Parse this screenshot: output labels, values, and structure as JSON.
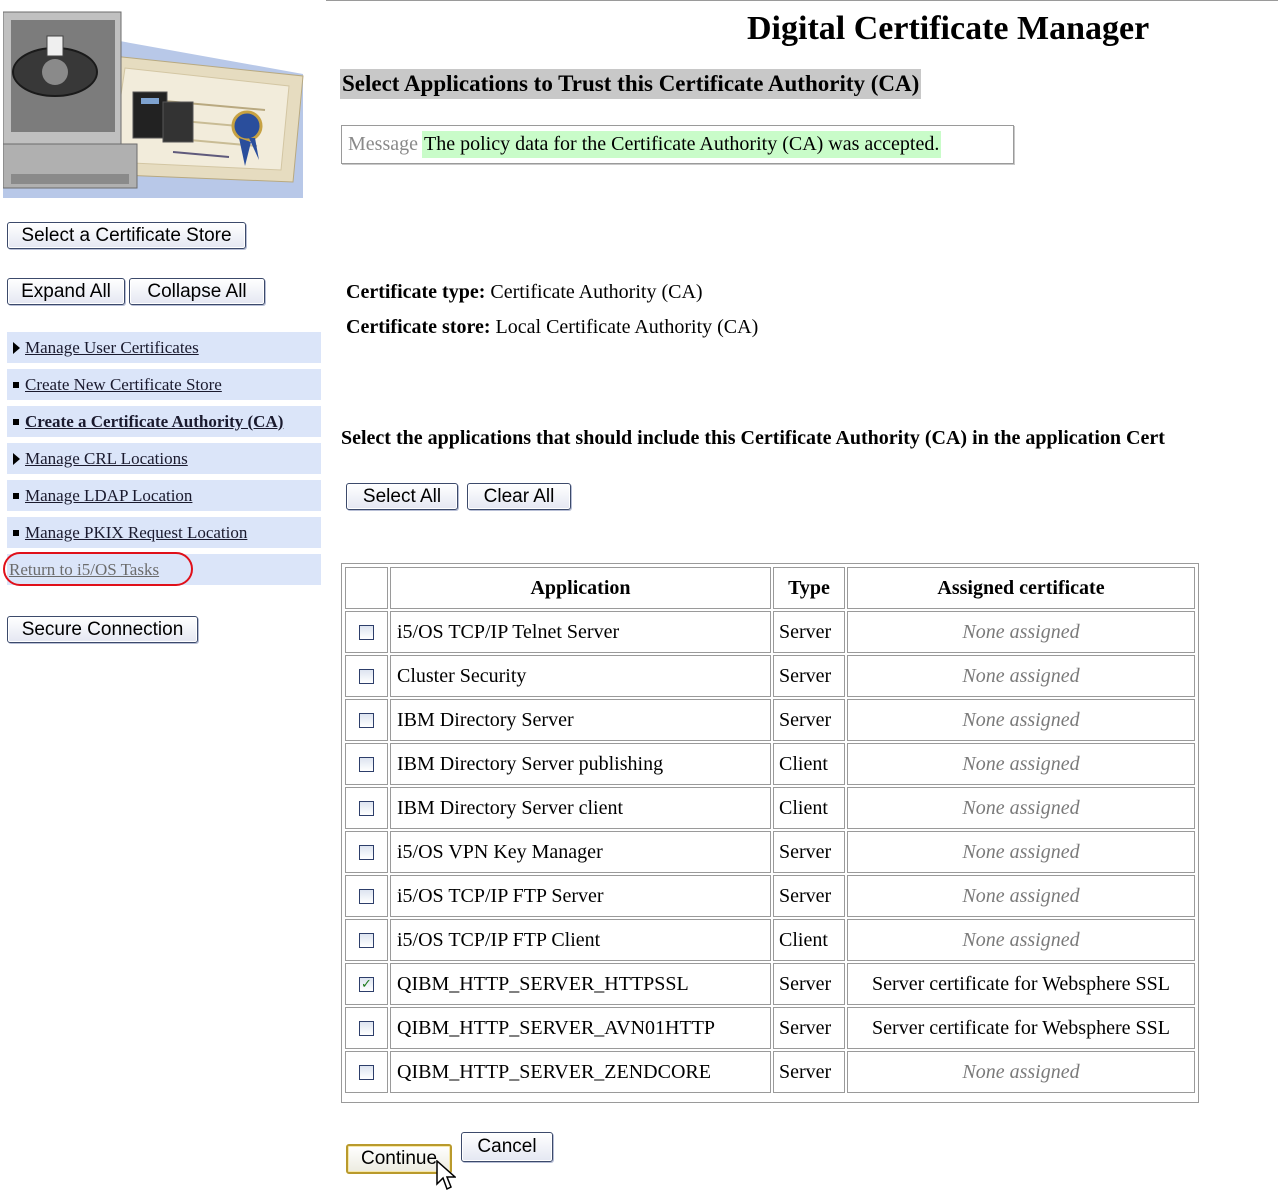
{
  "header": {
    "title": "Digital Certificate Manager"
  },
  "sidebar": {
    "select_store_button": "Select a Certificate Store",
    "expand_all_button": "Expand All",
    "collapse_all_button": "Collapse All",
    "items": [
      {
        "label": "Manage User Certificates",
        "marker": "triangle",
        "bold": false
      },
      {
        "label": "Create New Certificate Store",
        "marker": "square",
        "bold": false
      },
      {
        "label": "Create a Certificate Authority (CA)",
        "marker": "square",
        "bold": true
      },
      {
        "label": "Manage CRL Locations",
        "marker": "triangle",
        "bold": false
      },
      {
        "label": "Manage LDAP Location",
        "marker": "square",
        "bold": false
      },
      {
        "label": "Manage PKIX Request Location",
        "marker": "square",
        "bold": false
      }
    ],
    "return_link": "Return to i5/OS Tasks",
    "secure_connection_button": "Secure Connection"
  },
  "main": {
    "section_title": "Select Applications to Trust this Certificate Authority (CA)",
    "message": {
      "label": "Message",
      "text": "The policy data for the Certificate Authority (CA) was accepted."
    },
    "certificate_type": {
      "label": "Certificate type:",
      "value": "Certificate Authority (CA)"
    },
    "certificate_store": {
      "label": "Certificate store:",
      "value": "Local Certificate Authority (CA)"
    },
    "instruction": "Select the applications that should include this Certificate Authority (CA) in the application Cert",
    "select_all_button": "Select All",
    "clear_all_button": "Clear All",
    "table": {
      "columns": [
        "Application",
        "Type",
        "Assigned certificate"
      ],
      "rows": [
        {
          "checked": false,
          "application": "i5/OS TCP/IP Telnet Server",
          "type": "Server",
          "certificate": "None assigned",
          "assigned": false
        },
        {
          "checked": false,
          "application": "Cluster Security",
          "type": "Server",
          "certificate": "None assigned",
          "assigned": false
        },
        {
          "checked": false,
          "application": "IBM Directory Server",
          "type": "Server",
          "certificate": "None assigned",
          "assigned": false
        },
        {
          "checked": false,
          "application": "IBM Directory Server publishing",
          "type": "Client",
          "certificate": "None assigned",
          "assigned": false
        },
        {
          "checked": false,
          "application": "IBM Directory Server client",
          "type": "Client",
          "certificate": "None assigned",
          "assigned": false
        },
        {
          "checked": false,
          "application": "i5/OS VPN Key Manager",
          "type": "Server",
          "certificate": "None assigned",
          "assigned": false
        },
        {
          "checked": false,
          "application": "i5/OS TCP/IP FTP Server",
          "type": "Server",
          "certificate": "None assigned",
          "assigned": false
        },
        {
          "checked": false,
          "application": "i5/OS TCP/IP FTP Client",
          "type": "Client",
          "certificate": "None assigned",
          "assigned": false
        },
        {
          "checked": true,
          "application": "QIBM_HTTP_SERVER_HTTPSSL",
          "type": "Server",
          "certificate": "Server certificate for Websphere SSL",
          "assigned": true
        },
        {
          "checked": false,
          "application": "QIBM_HTTP_SERVER_AVN01HTTP",
          "type": "Server",
          "certificate": "Server certificate for Websphere SSL",
          "assigned": true
        },
        {
          "checked": false,
          "application": "QIBM_HTTP_SERVER_ZENDCORE",
          "type": "Server",
          "certificate": "None assigned",
          "assigned": false
        }
      ]
    },
    "continue_button": "Continue",
    "cancel_button": "Cancel"
  },
  "colors": {
    "nav_background": "#dbe5f9",
    "message_highlight": "#c9fcc9",
    "section_title_background": "#c8c8c8",
    "highlight_oval": "#e0101a"
  },
  "icons": {
    "logo": "certificate-computer-logo",
    "triangle": "expand-triangle-icon",
    "square": "bullet-square-icon",
    "check": "checkmark-icon",
    "cursor": "mouse-pointer-icon"
  }
}
